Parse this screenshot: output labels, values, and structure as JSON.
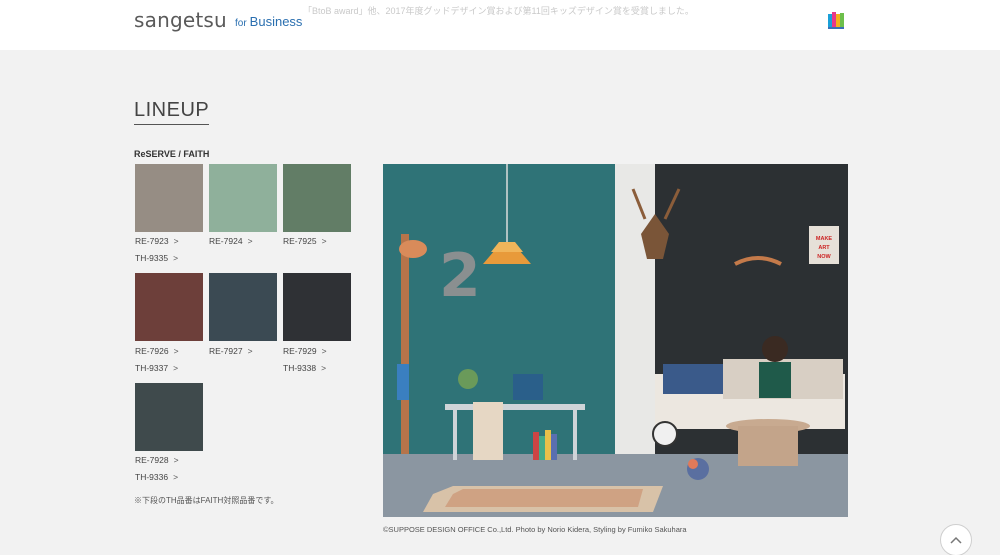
{
  "header": {
    "brand": "sangetsu",
    "brand_for": "for",
    "brand_business": "Business",
    "notice": "「BtoB award」他、2017年度グッドデザイン賞および第11回キッズデザイン賞を受賞しました。",
    "book_icon": "book-icon"
  },
  "lineup": {
    "title": "LINEUP",
    "series": "ReSERVE / FAITH",
    "note": "※下段のTH品番はFAITH対照品番です。",
    "swatches": [
      {
        "color": "#968d84",
        "codes": [
          "RE-7923",
          "TH-9335"
        ]
      },
      {
        "color": "#8fb09b",
        "codes": [
          "RE-7924"
        ]
      },
      {
        "color": "#627d66",
        "codes": [
          "RE-7925"
        ]
      },
      {
        "color": "#6d3f3a",
        "codes": [
          "RE-7926",
          "TH-9337"
        ]
      },
      {
        "color": "#3b4a53",
        "codes": [
          "RE-7927"
        ]
      },
      {
        "color": "#2f3135",
        "codes": [
          "RE-7929",
          "TH-9338"
        ]
      },
      {
        "color": "#3f4a4c",
        "codes": [
          "RE-7928",
          "TH-9336"
        ]
      }
    ],
    "chevron": ">"
  },
  "photo": {
    "credit": "©SUPPOSE DESIGN OFFICE Co.,Ltd. Photo by Norio Kidera, Styling by Fumiko Sakuhara",
    "number": "2",
    "poster": "MAKE ART NOW"
  },
  "scroll_top_icon": "chevron-up-icon"
}
